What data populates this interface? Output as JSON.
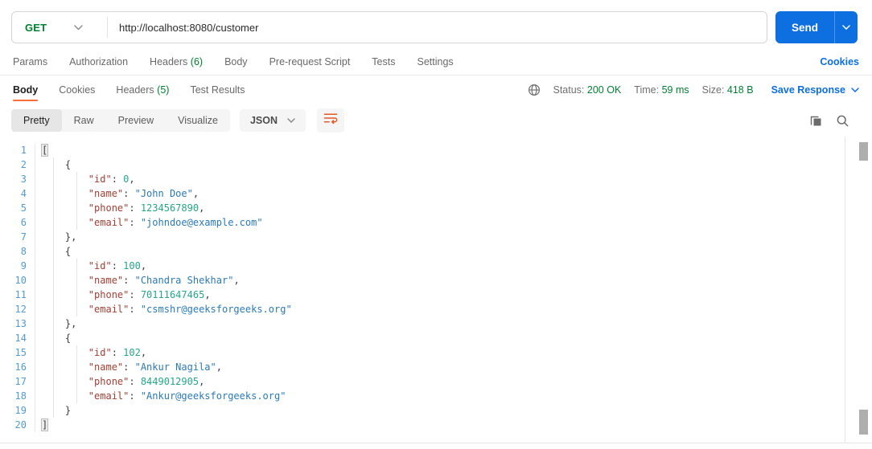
{
  "colors": {
    "accent_green": "#007f31",
    "accent_blue": "#0d6fe0",
    "accent_orange": "#ff6c37",
    "token_key": "#a33f35",
    "token_string": "#2b7ab9",
    "token_number": "#26a58c",
    "token_punct": "#3d3d3d",
    "line_number": "#539bd2"
  },
  "request": {
    "method": "GET",
    "url": "http://localhost:8080/customer",
    "send_label": "Send",
    "tabs": [
      {
        "label": "Params"
      },
      {
        "label": "Authorization"
      },
      {
        "label": "Headers",
        "badge": "(6)"
      },
      {
        "label": "Body"
      },
      {
        "label": "Pre-request Script"
      },
      {
        "label": "Tests"
      },
      {
        "label": "Settings"
      }
    ],
    "cookies_link": "Cookies"
  },
  "response": {
    "tabs": [
      {
        "label": "Body"
      },
      {
        "label": "Cookies"
      },
      {
        "label": "Headers",
        "badge": "(5)"
      },
      {
        "label": "Test Results"
      }
    ],
    "status_label": "Status:",
    "status_value": "200 OK",
    "time_label": "Time:",
    "time_value": "59 ms",
    "size_label": "Size:",
    "size_value": "418 B",
    "save_response_label": "Save Response",
    "views": [
      {
        "label": "Pretty"
      },
      {
        "label": "Raw"
      },
      {
        "label": "Preview"
      },
      {
        "label": "Visualize"
      }
    ],
    "format": "JSON"
  },
  "code": {
    "lines": [
      {
        "n": 1,
        "tokens": [
          {
            "c": "pun",
            "v": "[",
            "hl": true
          }
        ]
      },
      {
        "n": 2,
        "tokens": [
          {
            "c": "pun",
            "v": "    {"
          }
        ]
      },
      {
        "n": 3,
        "tokens": [
          {
            "c": "sp",
            "v": "        "
          },
          {
            "c": "key",
            "v": "\"id\""
          },
          {
            "c": "pun",
            "v": ": "
          },
          {
            "c": "num",
            "v": "0"
          },
          {
            "c": "pun",
            "v": ","
          }
        ]
      },
      {
        "n": 4,
        "tokens": [
          {
            "c": "sp",
            "v": "        "
          },
          {
            "c": "key",
            "v": "\"name\""
          },
          {
            "c": "pun",
            "v": ": "
          },
          {
            "c": "str",
            "v": "\"John Doe\""
          },
          {
            "c": "pun",
            "v": ","
          }
        ]
      },
      {
        "n": 5,
        "tokens": [
          {
            "c": "sp",
            "v": "        "
          },
          {
            "c": "key",
            "v": "\"phone\""
          },
          {
            "c": "pun",
            "v": ": "
          },
          {
            "c": "num",
            "v": "1234567890"
          },
          {
            "c": "pun",
            "v": ","
          }
        ]
      },
      {
        "n": 6,
        "tokens": [
          {
            "c": "sp",
            "v": "        "
          },
          {
            "c": "key",
            "v": "\"email\""
          },
          {
            "c": "pun",
            "v": ": "
          },
          {
            "c": "str",
            "v": "\"johndoe@example.com\""
          }
        ]
      },
      {
        "n": 7,
        "tokens": [
          {
            "c": "pun",
            "v": "    },"
          }
        ]
      },
      {
        "n": 8,
        "tokens": [
          {
            "c": "pun",
            "v": "    {"
          }
        ]
      },
      {
        "n": 9,
        "tokens": [
          {
            "c": "sp",
            "v": "        "
          },
          {
            "c": "key",
            "v": "\"id\""
          },
          {
            "c": "pun",
            "v": ": "
          },
          {
            "c": "num",
            "v": "100"
          },
          {
            "c": "pun",
            "v": ","
          }
        ]
      },
      {
        "n": 10,
        "tokens": [
          {
            "c": "sp",
            "v": "        "
          },
          {
            "c": "key",
            "v": "\"name\""
          },
          {
            "c": "pun",
            "v": ": "
          },
          {
            "c": "str",
            "v": "\"Chandra Shekhar\""
          },
          {
            "c": "pun",
            "v": ","
          }
        ]
      },
      {
        "n": 11,
        "tokens": [
          {
            "c": "sp",
            "v": "        "
          },
          {
            "c": "key",
            "v": "\"phone\""
          },
          {
            "c": "pun",
            "v": ": "
          },
          {
            "c": "num",
            "v": "70111647465"
          },
          {
            "c": "pun",
            "v": ","
          }
        ]
      },
      {
        "n": 12,
        "tokens": [
          {
            "c": "sp",
            "v": "        "
          },
          {
            "c": "key",
            "v": "\"email\""
          },
          {
            "c": "pun",
            "v": ": "
          },
          {
            "c": "str",
            "v": "\"csmshr@geeksforgeeks.org\""
          }
        ]
      },
      {
        "n": 13,
        "tokens": [
          {
            "c": "pun",
            "v": "    },"
          }
        ]
      },
      {
        "n": 14,
        "tokens": [
          {
            "c": "pun",
            "v": "    {"
          }
        ]
      },
      {
        "n": 15,
        "tokens": [
          {
            "c": "sp",
            "v": "        "
          },
          {
            "c": "key",
            "v": "\"id\""
          },
          {
            "c": "pun",
            "v": ": "
          },
          {
            "c": "num",
            "v": "102"
          },
          {
            "c": "pun",
            "v": ","
          }
        ]
      },
      {
        "n": 16,
        "tokens": [
          {
            "c": "sp",
            "v": "        "
          },
          {
            "c": "key",
            "v": "\"name\""
          },
          {
            "c": "pun",
            "v": ": "
          },
          {
            "c": "str",
            "v": "\"Ankur Nagila\""
          },
          {
            "c": "pun",
            "v": ","
          }
        ]
      },
      {
        "n": 17,
        "tokens": [
          {
            "c": "sp",
            "v": "        "
          },
          {
            "c": "key",
            "v": "\"phone\""
          },
          {
            "c": "pun",
            "v": ": "
          },
          {
            "c": "num",
            "v": "8449012905"
          },
          {
            "c": "pun",
            "v": ","
          }
        ]
      },
      {
        "n": 18,
        "tokens": [
          {
            "c": "sp",
            "v": "        "
          },
          {
            "c": "key",
            "v": "\"email\""
          },
          {
            "c": "pun",
            "v": ": "
          },
          {
            "c": "str",
            "v": "\"Ankur@geeksforgeeks.org\""
          }
        ]
      },
      {
        "n": 19,
        "tokens": [
          {
            "c": "pun",
            "v": "    }"
          }
        ]
      },
      {
        "n": 20,
        "tokens": [
          {
            "c": "pun",
            "v": "]",
            "hl": true
          }
        ]
      }
    ]
  }
}
